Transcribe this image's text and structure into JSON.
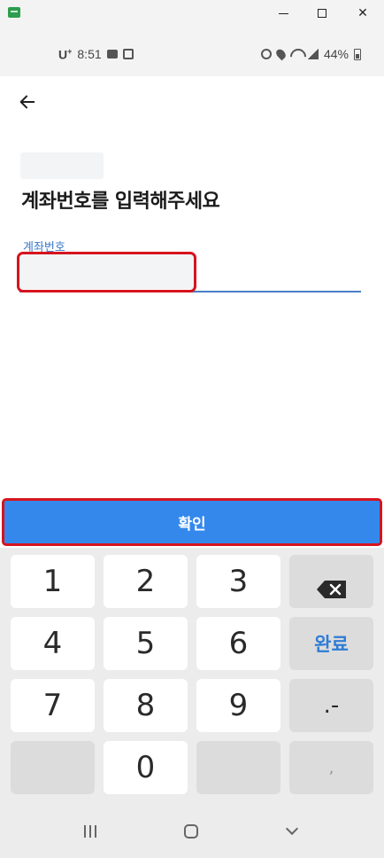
{
  "window": {
    "minimize_icon": "minimize-icon",
    "maximize_icon": "maximize-icon",
    "close_label": "✕"
  },
  "statusbar": {
    "carrier": "U",
    "carrier_sup": "+",
    "time": "8:51",
    "battery": "44%"
  },
  "page": {
    "back_icon": "arrow-left-icon",
    "heading": "계좌번호를 입력해주세요",
    "field_label": "계좌번호",
    "field_value": ""
  },
  "confirm": {
    "label": "확인",
    "color": "#3488ec"
  },
  "keypad": {
    "keys": [
      "1",
      "2",
      "3",
      "4",
      "5",
      "6",
      "7",
      "8",
      "9",
      "0"
    ],
    "done_label": "완료",
    "dot_dash_label": ".-",
    "comma_label": ","
  },
  "highlight_color": "#d6141e"
}
